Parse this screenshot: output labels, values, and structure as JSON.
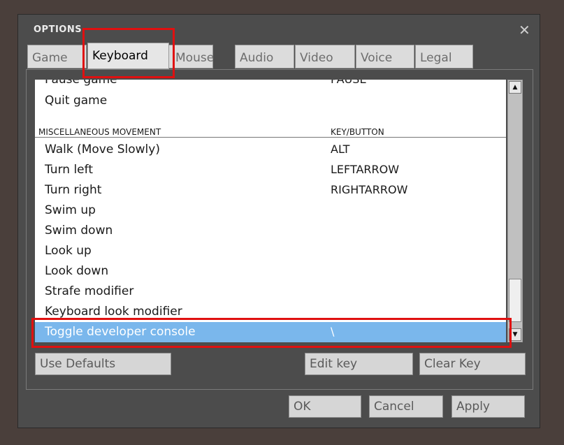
{
  "window": {
    "title": "OPTIONS",
    "close_glyph": "✕"
  },
  "tabs": [
    {
      "label": "Game"
    },
    {
      "label": "Keyboard"
    },
    {
      "label": "Mouse"
    },
    {
      "label": "Audio"
    },
    {
      "label": "Video"
    },
    {
      "label": "Voice"
    },
    {
      "label": "Legal"
    }
  ],
  "active_tab": "Keyboard",
  "list": {
    "rows": [
      {
        "label": "Pause game",
        "key": "PAUSE"
      },
      {
        "label": "Quit game",
        "key": ""
      },
      {
        "label": "MISCELLANEOUS MOVEMENT",
        "key": "KEY/BUTTON"
      },
      {
        "label": "Walk (Move Slowly)",
        "key": "ALT"
      },
      {
        "label": "Turn left",
        "key": "LEFTARROW"
      },
      {
        "label": "Turn right",
        "key": "RIGHTARROW"
      },
      {
        "label": "Swim up",
        "key": ""
      },
      {
        "label": "Swim down",
        "key": ""
      },
      {
        "label": "Look up",
        "key": ""
      },
      {
        "label": "Look down",
        "key": ""
      },
      {
        "label": "Strafe modifier",
        "key": ""
      },
      {
        "label": "Keyboard look modifier",
        "key": ""
      },
      {
        "label": "Toggle developer console",
        "key": "\\"
      }
    ],
    "selected_label": "Toggle developer console"
  },
  "scrollbar": {
    "up_glyph": "▲",
    "down_glyph": "▼"
  },
  "buttons": {
    "use_defaults": "Use Defaults",
    "edit_key": "Edit key",
    "clear_key": "Clear Key",
    "ok": "OK",
    "cancel": "Cancel",
    "apply": "Apply"
  },
  "colors": {
    "highlight": "#e01010",
    "selection": "#7ab7ec"
  }
}
